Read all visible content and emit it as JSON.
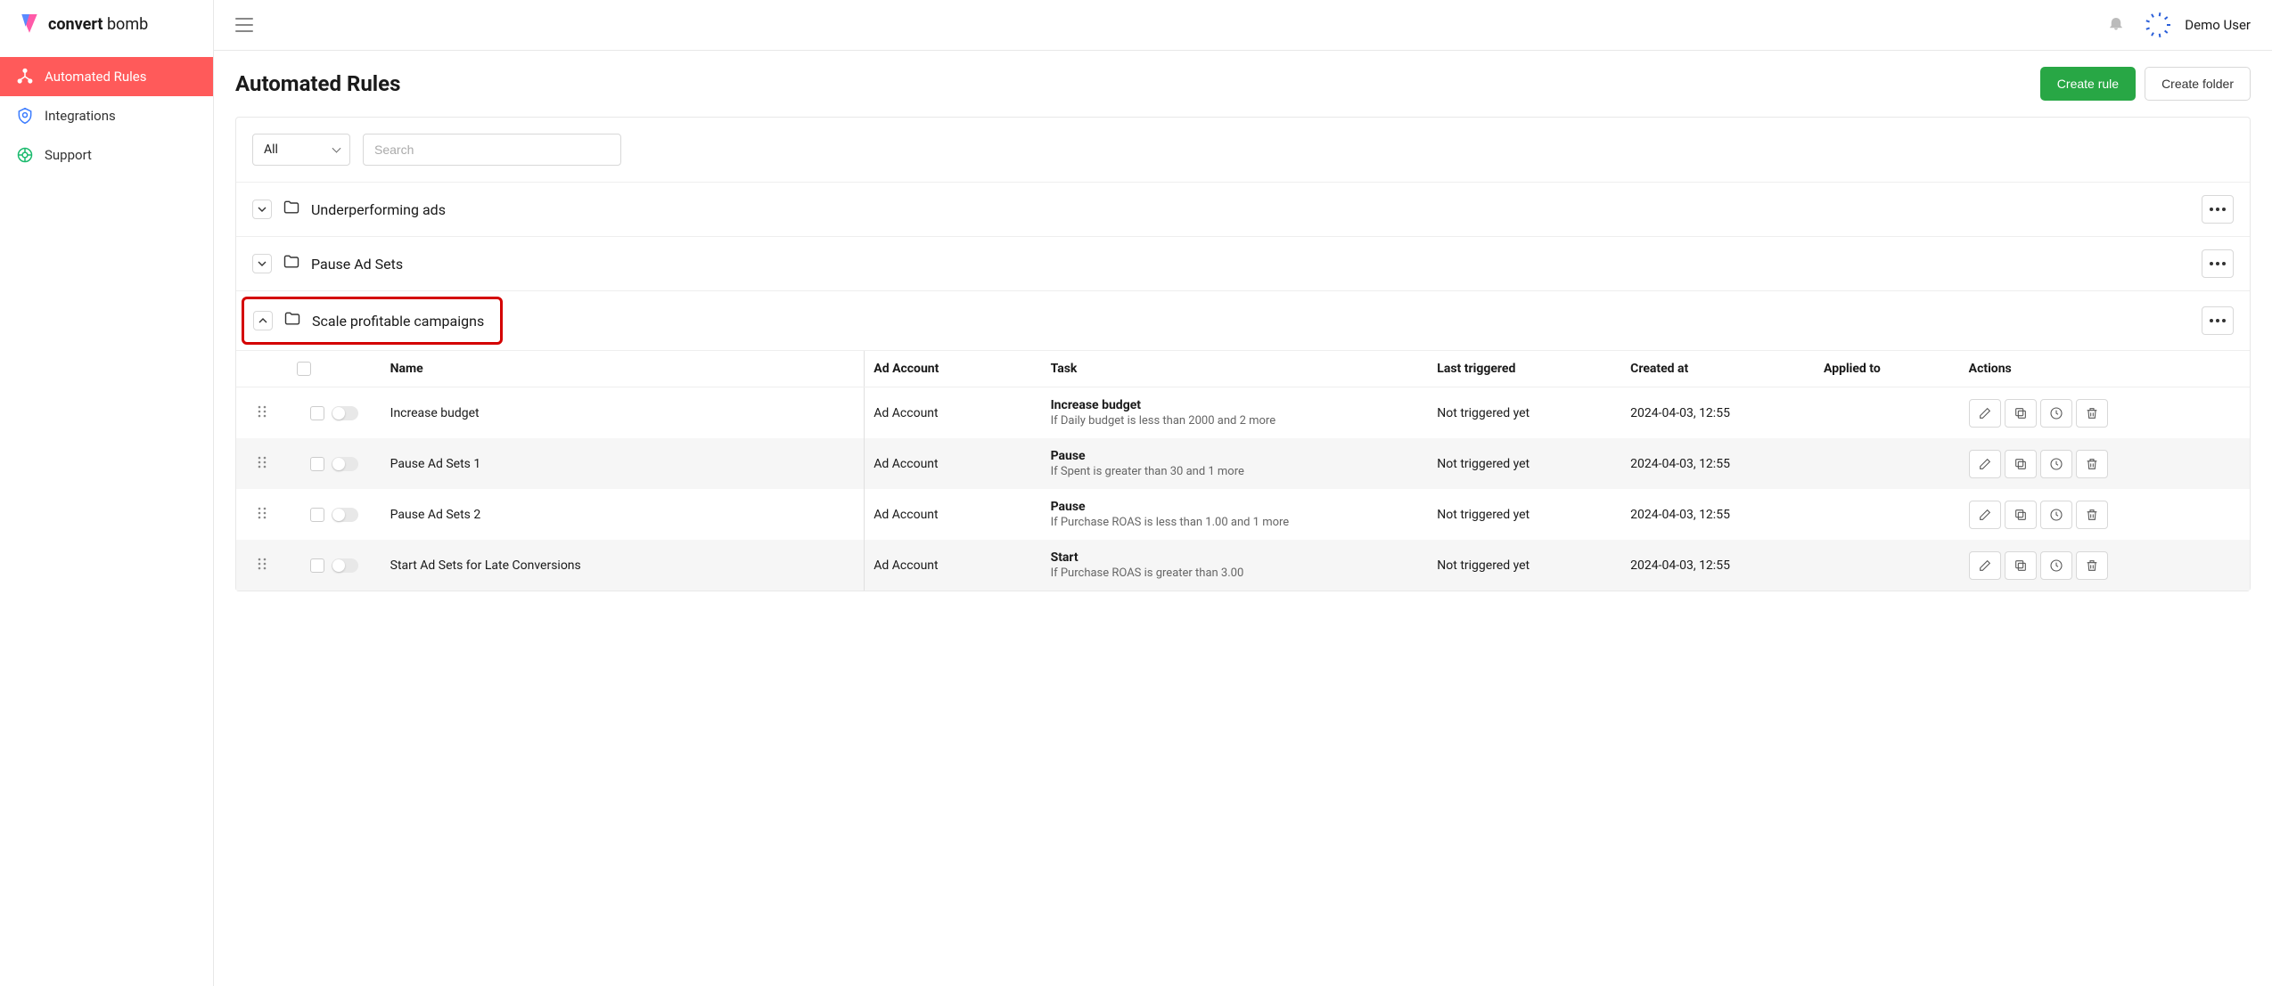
{
  "brand": {
    "name_bold": "convert",
    "name_light": " bomb"
  },
  "user": {
    "name": "Demo User"
  },
  "nav": {
    "items": [
      {
        "label": "Automated Rules",
        "key": "rules"
      },
      {
        "label": "Integrations",
        "key": "integrations"
      },
      {
        "label": "Support",
        "key": "support"
      }
    ]
  },
  "page": {
    "title": "Automated Rules",
    "create_rule_label": "Create rule",
    "create_folder_label": "Create folder"
  },
  "filters": {
    "select_value": "All",
    "search_placeholder": "Search"
  },
  "folders": [
    {
      "name": "Underperforming ads",
      "expanded": false
    },
    {
      "name": "Pause Ad Sets",
      "expanded": false
    },
    {
      "name": "Scale profitable campaigns",
      "expanded": true,
      "highlighted": true
    }
  ],
  "table": {
    "headers": {
      "name": "Name",
      "ad_account": "Ad Account",
      "task": "Task",
      "last_triggered": "Last triggered",
      "created_at": "Created at",
      "applied_to": "Applied to",
      "actions": "Actions"
    },
    "rows": [
      {
        "name": "Increase budget",
        "ad_account": "Ad Account",
        "task_title": "Increase budget",
        "task_desc": "If Daily budget is less than 2000 and 2 more",
        "last_triggered": "Not triggered yet",
        "created_at": "2024-04-03, 12:55"
      },
      {
        "name": "Pause Ad Sets 1",
        "ad_account": "Ad Account",
        "task_title": "Pause",
        "task_desc": "If Spent is greater than 30 and 1 more",
        "last_triggered": "Not triggered yet",
        "created_at": "2024-04-03, 12:55"
      },
      {
        "name": "Pause Ad Sets 2",
        "ad_account": "Ad Account",
        "task_title": "Pause",
        "task_desc": "If Purchase ROAS is less than 1.00 and 1 more",
        "last_triggered": "Not triggered yet",
        "created_at": "2024-04-03, 12:55"
      },
      {
        "name": "Start Ad Sets for Late Conversions",
        "ad_account": "Ad Account",
        "task_title": "Start",
        "task_desc": "If Purchase ROAS is greater than 3.00",
        "last_triggered": "Not triggered yet",
        "created_at": "2024-04-03, 12:55"
      }
    ]
  }
}
